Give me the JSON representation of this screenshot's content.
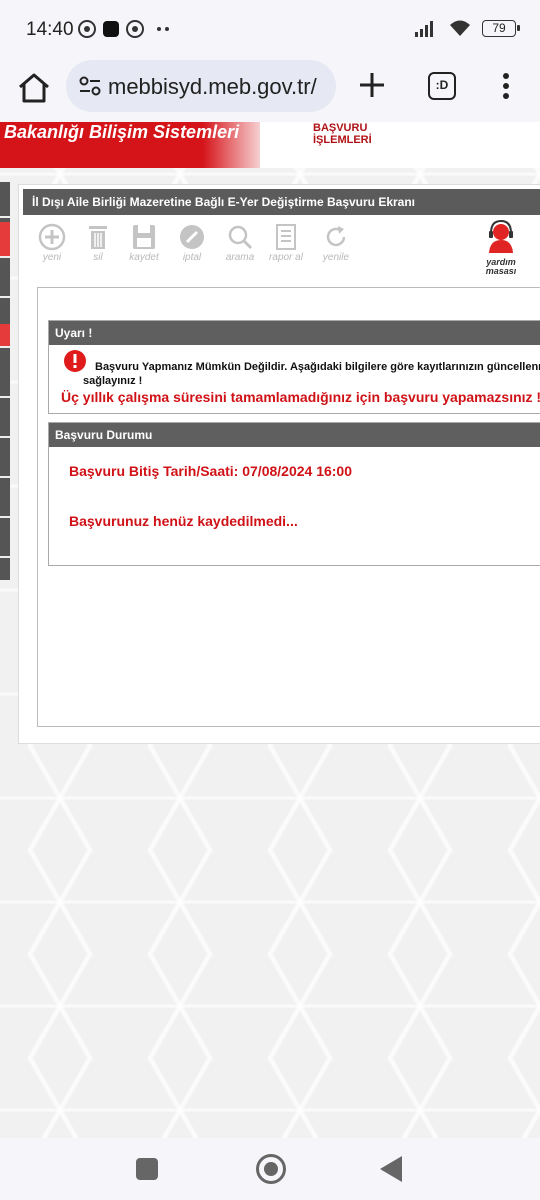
{
  "status_bar": {
    "time": "14:40",
    "battery": "79",
    "icons": [
      "chrome-icon",
      "app-icon",
      "chrome-icon",
      "more-dots-icon",
      "signal-icon",
      "wifi-icon",
      "battery-icon"
    ]
  },
  "browser": {
    "url": "mebbisyd.meb.gov.tr/",
    "tabs_label": ":D"
  },
  "site": {
    "brand": "Bakanlığı Bilişim Sistemleri",
    "menu_line1": "BAŞVURU",
    "menu_line2": "İŞLEMLERİ"
  },
  "panel": {
    "title": "İl Dışı Aile Birliği Mazeretine Bağlı E-Yer Değiştirme Başvuru Ekranı"
  },
  "toolbar": {
    "items": [
      {
        "label": "yeni",
        "icon": "add-circle-icon"
      },
      {
        "label": "sil",
        "icon": "trash-icon"
      },
      {
        "label": "kaydet",
        "icon": "save-icon"
      },
      {
        "label": "iptal",
        "icon": "cancel-pencil-icon"
      },
      {
        "label": "arama",
        "icon": "search-icon"
      },
      {
        "label": "rapor al",
        "icon": "report-icon"
      },
      {
        "label": "yenile",
        "icon": "refresh-icon"
      }
    ],
    "help_line1": "yardım",
    "help_line2": "masası"
  },
  "warning": {
    "title": "Uyarı !",
    "line1": "Başvuru Yapmanız Mümkün Değildir. Aşağıdaki bilgilere göre kayıtlarınızın güncellenmesini",
    "line2": "sağlayınız !",
    "red": "Üç yıllık çalışma süresini tamamlamadığınız için başvuru yapamazsınız !!"
  },
  "status": {
    "title": "Başvuru Durumu",
    "deadline": "Başvuru Bitiş Tarih/Saati: 07/08/2024 16:00",
    "message": "Başvurunuz henüz kaydedilmedi..."
  },
  "colors": {
    "brand_red": "#d5141a",
    "header_gray": "#5b5b5b",
    "alert_red": "#d01217"
  }
}
